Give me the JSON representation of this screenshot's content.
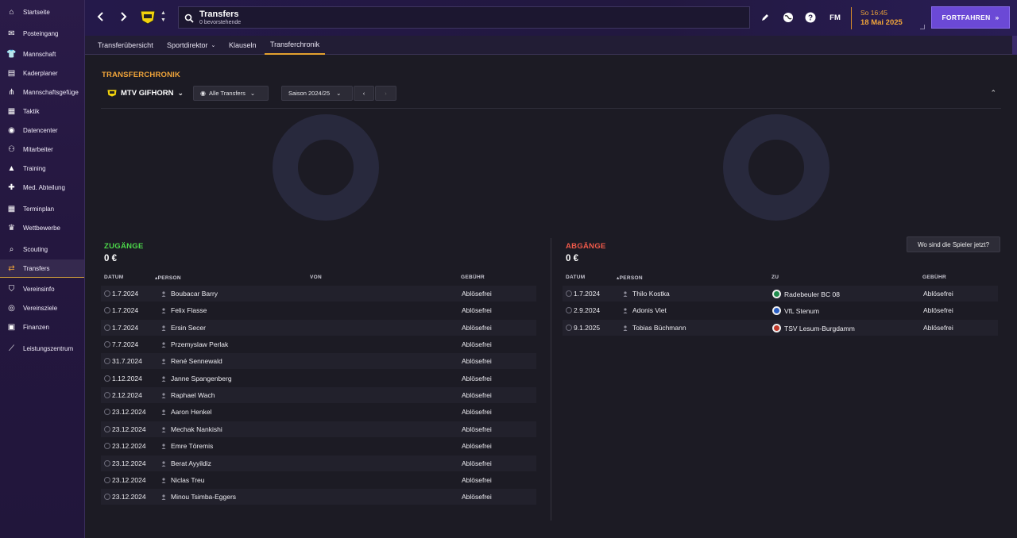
{
  "sidebar": {
    "items": [
      {
        "label": "Startseite",
        "icon": "home-icon"
      },
      {
        "label": "Posteingang",
        "icon": "inbox-icon"
      },
      {
        "label": "Mannschaft",
        "icon": "shirt-icon"
      },
      {
        "label": "Kaderplaner",
        "icon": "clipboard-icon"
      },
      {
        "label": "Mannschaftsgefüge",
        "icon": "hierarchy-icon"
      },
      {
        "label": "Taktik",
        "icon": "tactics-icon"
      },
      {
        "label": "Datencenter",
        "icon": "data-icon"
      },
      {
        "label": "Mitarbeiter",
        "icon": "staff-icon"
      },
      {
        "label": "Training",
        "icon": "training-icon"
      },
      {
        "label": "Med. Abteilung",
        "icon": "medical-icon"
      },
      {
        "label": "Terminplan",
        "icon": "calendar-icon"
      },
      {
        "label": "Wettbewerbe",
        "icon": "trophy-icon"
      },
      {
        "label": "Scouting",
        "icon": "scouting-icon"
      },
      {
        "label": "Transfers",
        "icon": "transfer-icon"
      },
      {
        "label": "Vereinsinfo",
        "icon": "shield-icon"
      },
      {
        "label": "Vereinsziele",
        "icon": "target-icon"
      },
      {
        "label": "Finanzen",
        "icon": "money-icon"
      },
      {
        "label": "Leistungszentrum",
        "icon": "academy-icon"
      }
    ],
    "active": "Transfers"
  },
  "topbar": {
    "title": "Transfers",
    "subtitle": "0 bevorstehende",
    "time": "So 16:45",
    "date": "18 Mai 2025",
    "continue_label": "FORTFAHREN",
    "fm_label": "FM"
  },
  "tabs": [
    {
      "label": "Transferübersicht",
      "active": false
    },
    {
      "label": "Sportdirektor",
      "active": false
    },
    {
      "label": "Klauseln",
      "active": false
    },
    {
      "label": "Transferchronik",
      "active": true
    }
  ],
  "main": {
    "section_title": "TRANSFERCHRONIK",
    "club": "MTV GIFHORN",
    "filter_transfers": "Alle Transfers",
    "filter_season": "Saison 2024/25",
    "where_button": "Wo sind die Spieler jetzt?"
  },
  "incoming": {
    "title": "ZUGÄNGE",
    "total": "0 €",
    "columns": {
      "date": "DATUM",
      "person": "PERSON",
      "from": "VON",
      "fee": "GEBÜHR"
    },
    "rows": [
      {
        "date": "1.7.2024",
        "person": "Boubacar Barry",
        "from": "",
        "fee": "Ablösefrei"
      },
      {
        "date": "1.7.2024",
        "person": "Felix Flasse",
        "from": "",
        "fee": "Ablösefrei"
      },
      {
        "date": "1.7.2024",
        "person": "Ersin Secer",
        "from": "",
        "fee": "Ablösefrei"
      },
      {
        "date": "7.7.2024",
        "person": "Przemyslaw Perlak",
        "from": "",
        "fee": "Ablösefrei"
      },
      {
        "date": "31.7.2024",
        "person": "René Sennewald",
        "from": "",
        "fee": "Ablösefrei"
      },
      {
        "date": "1.12.2024",
        "person": "Janne Spangenberg",
        "from": "",
        "fee": "Ablösefrei"
      },
      {
        "date": "2.12.2024",
        "person": "Raphael Wach",
        "from": "",
        "fee": "Ablösefrei"
      },
      {
        "date": "23.12.2024",
        "person": "Aaron Henkel",
        "from": "",
        "fee": "Ablösefrei"
      },
      {
        "date": "23.12.2024",
        "person": "Mechak Nankishi",
        "from": "",
        "fee": "Ablösefrei"
      },
      {
        "date": "23.12.2024",
        "person": "Emre Töremis",
        "from": "",
        "fee": "Ablösefrei"
      },
      {
        "date": "23.12.2024",
        "person": "Berat Ayyildiz",
        "from": "",
        "fee": "Ablösefrei"
      },
      {
        "date": "23.12.2024",
        "person": "Niclas Treu",
        "from": "",
        "fee": "Ablösefrei"
      },
      {
        "date": "23.12.2024",
        "person": "Minou Tsimba-Eggers",
        "from": "",
        "fee": "Ablösefrei"
      }
    ]
  },
  "outgoing": {
    "title": "ABGÄNGE",
    "total": "0 €",
    "columns": {
      "date": "DATUM",
      "person": "PERSON",
      "to": "ZU",
      "fee": "GEBÜHR"
    },
    "rows": [
      {
        "date": "1.7.2024",
        "person": "Thilo Kostka",
        "to": "Radebeuler BC 08",
        "fee": "Ablösefrei",
        "badge_color": "#1f8a4c"
      },
      {
        "date": "2.9.2024",
        "person": "Adonis Viet",
        "to": "VfL Stenum",
        "fee": "Ablösefrei",
        "badge_color": "#2a5fc4"
      },
      {
        "date": "9.1.2025",
        "person": "Tobias Büchmann",
        "to": "TSV Lesum-Burgdamm",
        "fee": "Ablösefrei",
        "badge_color": "#c0392b"
      }
    ]
  },
  "colors": {
    "accent": "#f1a53a",
    "incoming": "#4cd94a",
    "outgoing": "#f05a4a",
    "button": "#6b49d6"
  }
}
